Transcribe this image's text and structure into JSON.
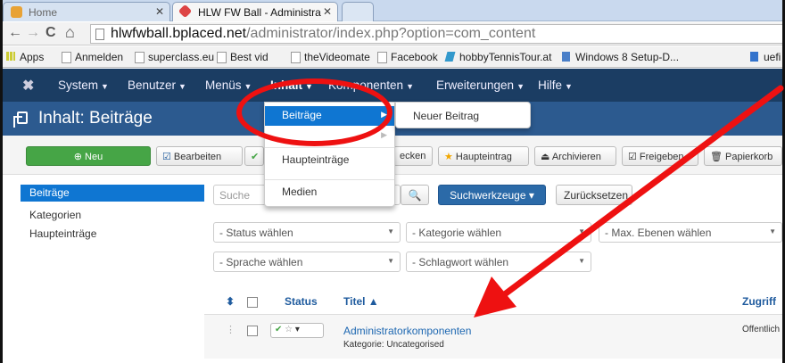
{
  "browser": {
    "tabs": [
      {
        "title": "Home"
      },
      {
        "title": "HLW FW Ball - Administra"
      }
    ],
    "url_domain": "hlwfwball.bplaced.net",
    "url_path": "/administrator/index.php?option=com_content",
    "bookmarks": [
      "Apps",
      "Anmelden",
      "superclass.eu",
      "Best vid",
      "theVideomate",
      "Facebook",
      "hobbyTennisTour.at",
      "Windows 8 Setup-D...",
      "uefi"
    ]
  },
  "admin_nav": {
    "items": [
      "System",
      "Benutzer",
      "Menüs",
      "Inhalt",
      "Komponenten",
      "Erweiterungen",
      "Hilfe"
    ]
  },
  "header": {
    "title": "Inhalt: Beiträge"
  },
  "toolbar": {
    "buttons": [
      "Neu",
      "Bearbeiten",
      "ecken",
      "Haupteintrag",
      "Archivieren",
      "Freigeben",
      "Papierkorb"
    ]
  },
  "sidebar": {
    "items": [
      "Beiträge",
      "Kategorien",
      "Haupteinträge"
    ]
  },
  "filters": {
    "search_placeholder": "Suche",
    "search_tools": "Suchwerkzeuge",
    "reset": "Zurücksetzen",
    "status": "- Status wählen",
    "category": "- Kategorie wählen",
    "levels": "- Max. Ebenen wählen",
    "language": "- Sprache wählen",
    "tag": "- Schlagwort wählen"
  },
  "table": {
    "headers": [
      "Status",
      "Titel ▲",
      "Zugriff"
    ],
    "rows": [
      {
        "title": "Administratorkomponenten",
        "category": "Kategorie: Uncategorised",
        "access": "Öffentlich"
      }
    ]
  },
  "dropdown": {
    "items": [
      "Beiträge",
      "Haupteinträge",
      "Medien"
    ],
    "submenu": [
      "Neuer Beitrag"
    ]
  },
  "colors": {
    "annotation": "#e11",
    "nav": "#1b3d63",
    "header": "#2c5a8f",
    "accent": "#0f76d2"
  }
}
